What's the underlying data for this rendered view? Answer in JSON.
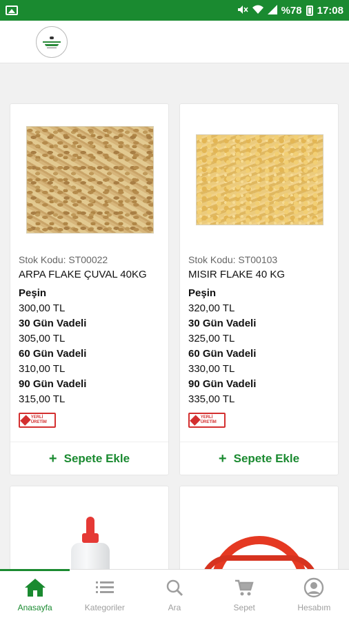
{
  "status_bar": {
    "battery": "%78",
    "time": "17:08",
    "icons": [
      "image-icon",
      "mute-icon",
      "wifi-icon",
      "signal-icon",
      "battery-icon"
    ]
  },
  "app": {
    "brand_color": "#1a8a30",
    "logo": "company-logo"
  },
  "products": [
    {
      "sku": "Stok Kodu: ST00022",
      "name": "ARPA FLAKE ÇUVAL 40KG",
      "prices": [
        {
          "label": "Peşin",
          "value": "300,00 TL"
        },
        {
          "label": "30 Gün Vadeli",
          "value": "305,00 TL"
        },
        {
          "label": "60 Gün Vadeli",
          "value": "310,00 TL"
        },
        {
          "label": "90 Gün Vadeli",
          "value": "315,00 TL"
        }
      ],
      "badge": "YERLİ ÜRETİM",
      "add_label": "Sepete Ekle"
    },
    {
      "sku": "Stok Kodu: ST00103",
      "name": "MISIR FLAKE 40 KG",
      "prices": [
        {
          "label": "Peşin",
          "value": "320,00 TL"
        },
        {
          "label": "30 Gün Vadeli",
          "value": "325,00 TL"
        },
        {
          "label": "60 Gün Vadeli",
          "value": "330,00 TL"
        },
        {
          "label": "90 Gün Vadeli",
          "value": "335,00 TL"
        }
      ],
      "badge": "YERLİ ÜRETİM",
      "add_label": "Sepete Ekle"
    }
  ],
  "bottom_nav": [
    {
      "label": "Anasayfa",
      "icon": "home-icon",
      "active": true
    },
    {
      "label": "Kategoriler",
      "icon": "list-icon",
      "active": false
    },
    {
      "label": "Ara",
      "icon": "search-icon",
      "active": false
    },
    {
      "label": "Sepet",
      "icon": "cart-icon",
      "active": false
    },
    {
      "label": "Hesabım",
      "icon": "account-icon",
      "active": false
    }
  ]
}
